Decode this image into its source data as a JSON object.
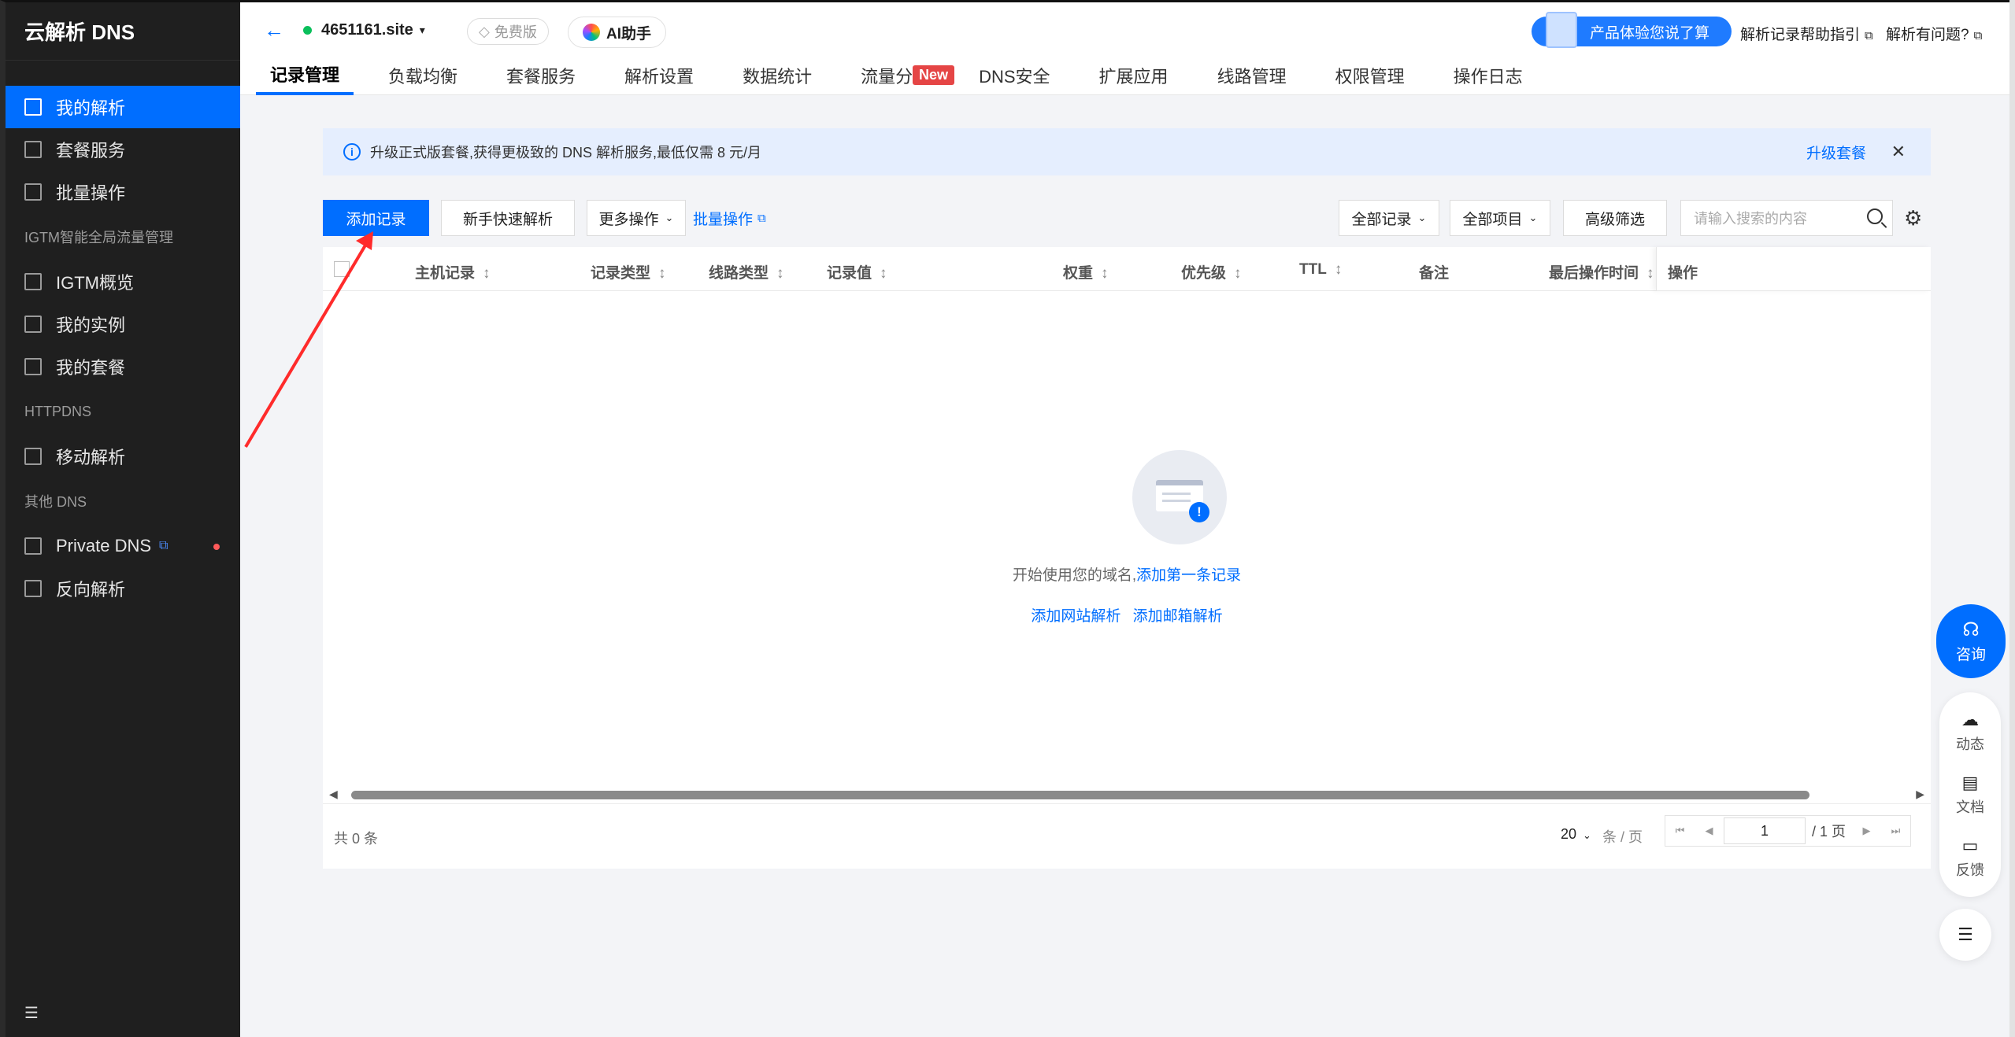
{
  "sidebar": {
    "brand": "云解析 DNS",
    "items": [
      {
        "label": "我的解析",
        "active": true
      },
      {
        "label": "套餐服务"
      },
      {
        "label": "批量操作"
      }
    ],
    "group_igtm": "IGTM智能全局流量管理",
    "igtm_items": [
      {
        "label": "IGTM概览"
      },
      {
        "label": "我的实例"
      },
      {
        "label": "我的套餐"
      }
    ],
    "group_httpdns": "HTTPDNS",
    "httpdns_items": [
      {
        "label": "移动解析"
      }
    ],
    "group_other": "其他 DNS",
    "other_items": [
      {
        "label": "Private DNS"
      },
      {
        "label": "反向解析"
      }
    ]
  },
  "topbar": {
    "domain": "4651161.site",
    "free_badge": "免费版",
    "ai_label": "AI助手",
    "feedback_pill": "产品体验您说了算",
    "help_link": "解析记录帮助指引",
    "question_link": "解析有问题?"
  },
  "tabs": [
    {
      "label": "记录管理",
      "active": true
    },
    {
      "label": "负载均衡"
    },
    {
      "label": "套餐服务"
    },
    {
      "label": "解析设置"
    },
    {
      "label": "数据统计"
    },
    {
      "label": "流量分析"
    },
    {
      "label": "DNS安全"
    },
    {
      "label": "扩展应用"
    },
    {
      "label": "线路管理"
    },
    {
      "label": "权限管理"
    },
    {
      "label": "操作日志"
    }
  ],
  "new_badge": "New",
  "notice": {
    "text": "升级正式版套餐,获得更极致的 DNS 解析服务,最低仅需 8 元/月",
    "action": "升级套餐"
  },
  "toolbar": {
    "add_record": "添加记录",
    "quick_resolve": "新手快速解析",
    "more_ops": "更多操作",
    "batch_ops": "批量操作",
    "all_records": "全部记录",
    "all_items": "全部项目",
    "advanced_filter": "高级筛选",
    "search_placeholder": "请输入搜索的内容"
  },
  "table": {
    "columns": [
      "主机记录",
      "记录类型",
      "线路类型",
      "记录值",
      "权重",
      "优先级",
      "TTL",
      "备注",
      "最后操作时间",
      "操作"
    ],
    "rows": [],
    "empty_text": "开始使用您的域名,",
    "empty_link": "添加第一条记录",
    "empty_link_website": "添加网站解析",
    "empty_link_mail": "添加邮箱解析"
  },
  "footer": {
    "total": "共 0 条",
    "page_size": "20",
    "per_page": "条 / 页",
    "current_page": "1",
    "page_total": "/ 1 页"
  },
  "float": {
    "consult": "咨询",
    "dynamic": "动态",
    "docs": "文档",
    "feedback": "反馈"
  },
  "colors": {
    "primary": "#006eff",
    "sidebar_bg": "#1f1f1f",
    "annotation_arrow": "#ff2b2b",
    "new_badge": "#e54545"
  }
}
